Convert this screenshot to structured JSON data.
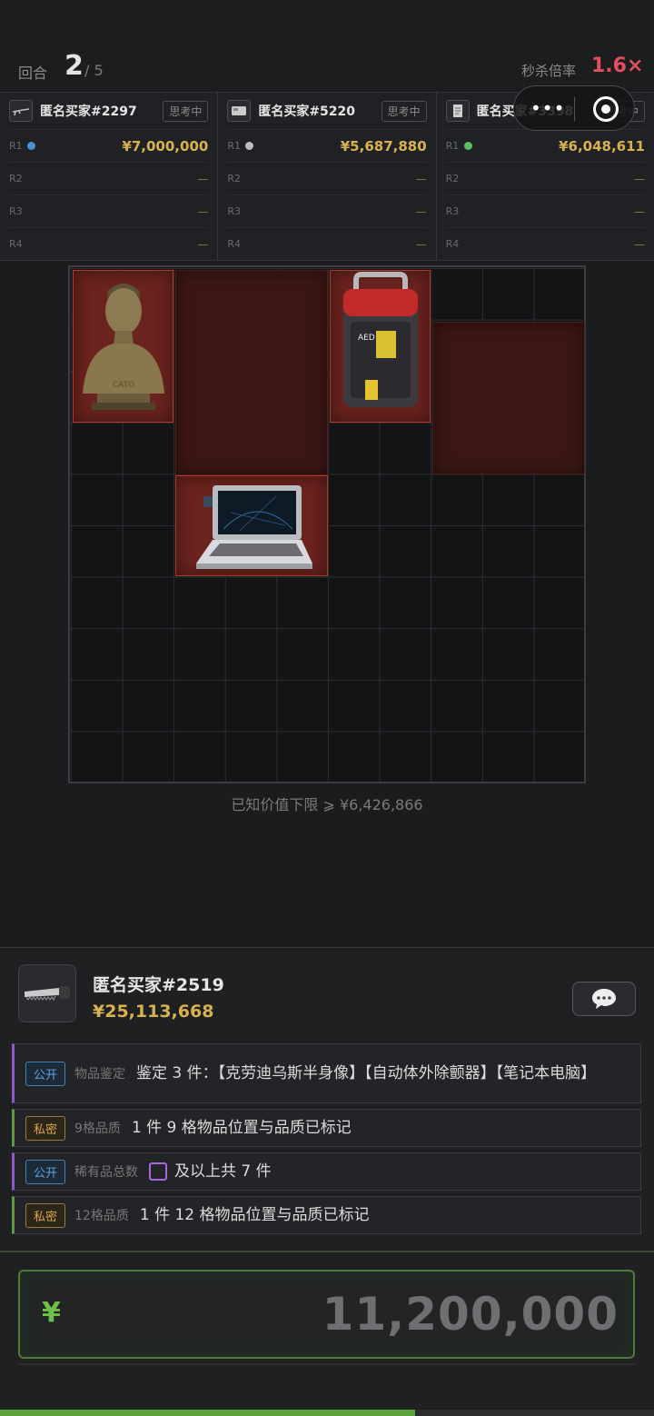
{
  "header": {
    "round_label": "回合",
    "round_current": "2",
    "round_total": "/ 5",
    "rate_label": "秒杀倍率",
    "rate_value": "1.6×"
  },
  "bidders": [
    {
      "name": "匿名买家#2297",
      "status": "思考中",
      "icon": "rifle-icon",
      "dot_color": "#4a90d9",
      "rounds": [
        {
          "r": "R1",
          "amount": "¥7,000,000"
        },
        {
          "r": "R2",
          "amount": "—"
        },
        {
          "r": "R3",
          "amount": "—"
        },
        {
          "r": "R4",
          "amount": "—"
        }
      ]
    },
    {
      "name": "匿名买家#5220",
      "status": "思考中",
      "icon": "card-icon",
      "dot_color": "#bdbdbd",
      "rounds": [
        {
          "r": "R1",
          "amount": "¥5,687,880"
        },
        {
          "r": "R2",
          "amount": "—"
        },
        {
          "r": "R3",
          "amount": "—"
        },
        {
          "r": "R4",
          "amount": "—"
        }
      ]
    },
    {
      "name": "匿名买家#3398",
      "status": "思考中",
      "icon": "notebook-icon",
      "dot_color": "#5bbf60",
      "rounds": [
        {
          "r": "R1",
          "amount": "¥6,048,611"
        },
        {
          "r": "R2",
          "amount": "—"
        },
        {
          "r": "R3",
          "amount": "—"
        },
        {
          "r": "R4",
          "amount": "—"
        }
      ]
    }
  ],
  "known_value": "已知价值下限 ⩾ ¥6,426,866",
  "me": {
    "name": "匿名买家#2519",
    "money": "¥25,113,668",
    "icon": "saw-icon"
  },
  "clues": [
    {
      "type": "公开",
      "label": "物品鉴定",
      "text": "鉴定 3 件：【克劳迪乌斯半身像】【自动体外除颤器】【笔记本电脑】"
    },
    {
      "type": "私密",
      "label": "9格品质",
      "text": "1 件 9 格物品位置与品质已标记"
    },
    {
      "type": "公开",
      "label": "稀有品总数",
      "text": "及以上共 7 件"
    },
    {
      "type": "私密",
      "label": "12格品质",
      "text": "1 件 12 格物品位置与品质已标记"
    }
  ],
  "bid_input": {
    "currency": "¥",
    "value": "11,200,000"
  },
  "progress": 0.635,
  "colors": {
    "accent_green": "#5ea43d",
    "gold": "#d8b34d",
    "rate_red": "#e2505f",
    "public_purple": "#8b5cc6"
  }
}
